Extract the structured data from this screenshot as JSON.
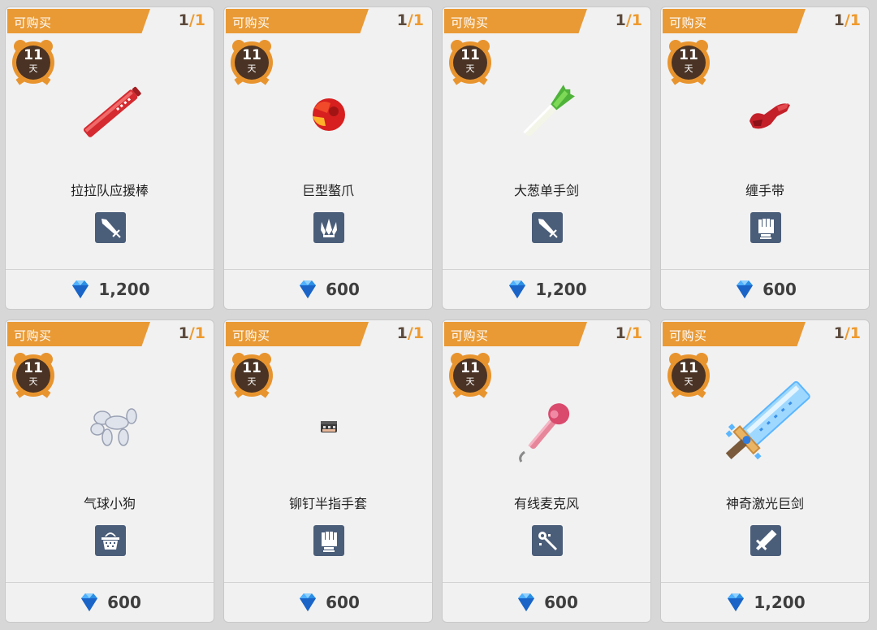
{
  "banner_label": "可购买",
  "days_unit": "天",
  "items": [
    {
      "name": "拉拉队应援棒",
      "status": "可购买",
      "stock_current": "1",
      "stock_max": "1",
      "days": "11",
      "price": "1,200",
      "item_icon": "cheer-stick-icon",
      "type_icon": "sword-type-icon"
    },
    {
      "name": "巨型螯爪",
      "status": "可购买",
      "stock_current": "1",
      "stock_max": "1",
      "days": "11",
      "price": "600",
      "item_icon": "giant-claw-icon",
      "type_icon": "claw-type-icon"
    },
    {
      "name": "大葱单手剑",
      "status": "可购买",
      "stock_current": "1",
      "stock_max": "1",
      "days": "11",
      "price": "1,200",
      "item_icon": "leek-sword-icon",
      "type_icon": "sword-type-icon"
    },
    {
      "name": "缠手带",
      "status": "可购买",
      "stock_current": "1",
      "stock_max": "1",
      "days": "11",
      "price": "600",
      "item_icon": "hand-wrap-icon",
      "type_icon": "fist-type-icon"
    },
    {
      "name": "气球小狗",
      "status": "可购买",
      "stock_current": "1",
      "stock_max": "1",
      "days": "11",
      "price": "600",
      "item_icon": "balloon-dog-icon",
      "type_icon": "basket-type-icon"
    },
    {
      "name": "铆钉半指手套",
      "status": "可购买",
      "stock_current": "1",
      "stock_max": "1",
      "days": "11",
      "price": "600",
      "item_icon": "studded-glove-icon",
      "type_icon": "fist-type-icon"
    },
    {
      "name": "有线麦克风",
      "status": "可购买",
      "stock_current": "1",
      "stock_max": "1",
      "days": "11",
      "price": "600",
      "item_icon": "microphone-icon",
      "type_icon": "wand-type-icon"
    },
    {
      "name": "神奇激光巨剑",
      "status": "可购买",
      "stock_current": "1",
      "stock_max": "1",
      "days": "11",
      "price": "1,200",
      "item_icon": "laser-greatsword-icon",
      "type_icon": "greatsword-type-icon"
    }
  ],
  "colors": {
    "banner": "#e99a35",
    "type_icon_bg": "#4a5d79",
    "gem": "#2a8fe6",
    "timer": "#e8942e"
  }
}
